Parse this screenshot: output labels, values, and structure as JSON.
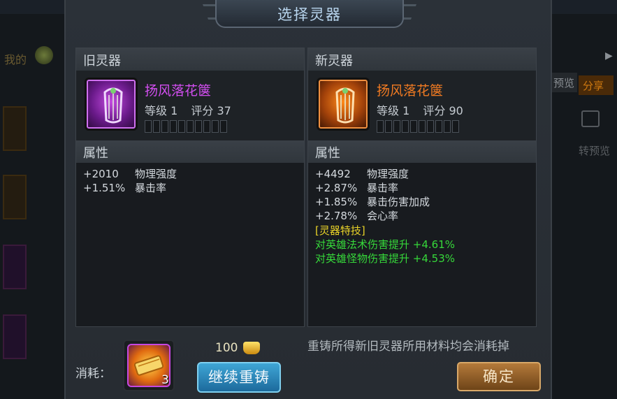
{
  "dialog": {
    "title": "选择灵器",
    "old_panel": {
      "header": "旧灵器",
      "item": {
        "name": "扬风落花箧",
        "quality_color": "#d24ef0",
        "level_label": "等级 1",
        "score_label": "评分 37",
        "slots": 10,
        "icon": "purple-harp-icon"
      },
      "attr_header": "属性",
      "attributes": [
        {
          "value": "+2010",
          "name": "物理强度"
        },
        {
          "value": "+1.51%",
          "name": "暴击率"
        }
      ]
    },
    "new_panel": {
      "header": "新灵器",
      "item": {
        "name": "扬风落花箧",
        "quality_color": "#f07a22",
        "level_label": "等级 1",
        "score_label": "评分 90",
        "slots": 10,
        "icon": "orange-harp-icon"
      },
      "attr_header": "属性",
      "attributes": [
        {
          "value": "+4492",
          "name": "物理强度"
        },
        {
          "value": "+2.87%",
          "name": "暴击率"
        },
        {
          "value": "+1.85%",
          "name": "暴击伤害加成"
        },
        {
          "value": "+2.78%",
          "name": "会心率"
        }
      ],
      "special_header": "[灵器特技]",
      "special_lines": [
        "对英雄法术伤害提升 +4.61%",
        "对英雄怪物伤害提升 +4.53%"
      ]
    },
    "cost": {
      "label": "消耗：",
      "item_count": "3",
      "item_icon": "gold-scroll-icon",
      "gold_amount": "100",
      "gold_icon": "gold-ingot-icon"
    },
    "reforge_button": "继续重铸",
    "notice": "重铸所得新旧灵器所用材料均会消耗掉",
    "confirm_button": "确定"
  },
  "background": {
    "left_text": "我的",
    "right_tag_1": "预览",
    "right_tag_2": "分享",
    "right_text": "转预览"
  }
}
